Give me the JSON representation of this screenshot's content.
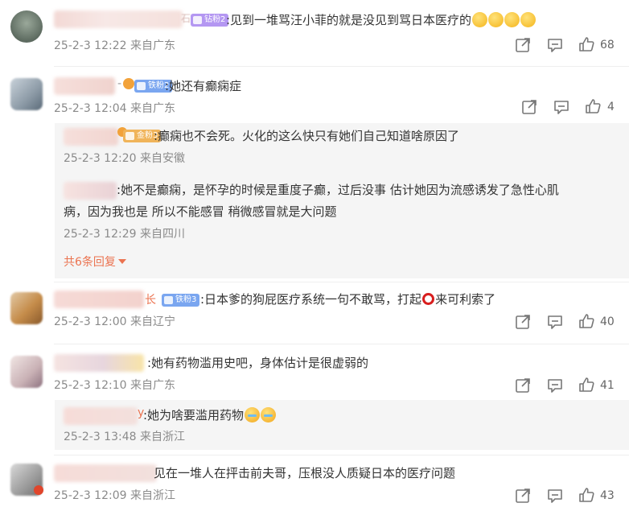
{
  "comments": [
    {
      "badge": "钻粉2",
      "badge_color": "#b497f2",
      "text": ":见到一堆骂汪小菲的就是没见到骂日本医疗的",
      "time": "25-2-3 12:22",
      "location": "来自广东",
      "likes": "68"
    },
    {
      "badge": "铁粉2",
      "badge_color": "#7aa6f0",
      "text": ":她还有癫痫症",
      "time": "25-2-3 12:04",
      "location": "来自广东",
      "likes": "4",
      "replies": [
        {
          "badge": "金粉3",
          "badge_color": "#f0b45a",
          "text": ":癫痫也不会死。火化的这么快只有她们自己知道啥原因了",
          "time": "25-2-3 12:20",
          "location": "来自安徽"
        },
        {
          "text_line1": ":她不是癫痫，是怀孕的时候是重度子癫，过后没事 估计她因为流感诱发了急性心肌",
          "text_line2": "病，因为我也是 所以不能感冒 稍微感冒就是大问题",
          "time": "25-2-3 12:29",
          "location": "来自四川"
        }
      ],
      "expand": "共6条回复"
    },
    {
      "name_tail": "长",
      "badge": "铁粉3",
      "badge_color": "#7aa6f0",
      "text_before": ":日本爹的狗屁医疗系统一句不敢骂，打起",
      "text_after": "来可利索了",
      "time": "25-2-3 12:00",
      "location": "来自辽宁",
      "likes": "40"
    },
    {
      "text": ":她有药物滥用史吧，身体估计是很虚弱的",
      "time": "25-2-3 12:10",
      "location": "来自广东",
      "likes": "41",
      "replies": [
        {
          "name_tail": "y",
          "text": ":她为啥要滥用药物",
          "time": "25-2-3 13:48",
          "location": "来自浙江"
        }
      ]
    },
    {
      "text": "见在一堆人在抨击前夫哥，压根没人质疑日本的医疗问题",
      "time": "25-2-3 12:09",
      "location": "来自浙江",
      "likes": "43"
    }
  ],
  "colors": {
    "accent": "#eb7350",
    "meta": "#8a8a8a"
  },
  "icons": [
    "share-icon",
    "comment-icon",
    "like-icon"
  ]
}
